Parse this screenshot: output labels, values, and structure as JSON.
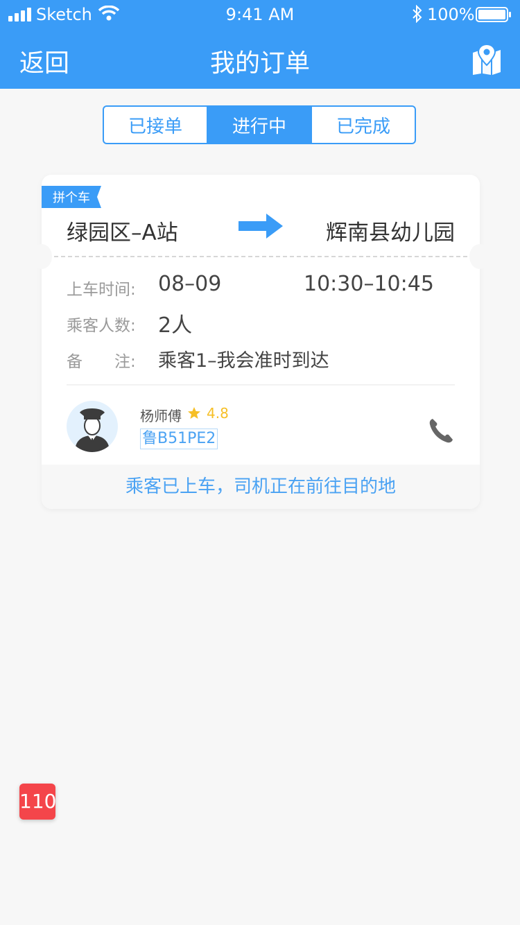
{
  "status_bar": {
    "carrier": "Sketch",
    "time": "9:41 AM",
    "battery": "100%"
  },
  "nav": {
    "back": "返回",
    "title": "我的订单",
    "map_icon": "map-pin-icon"
  },
  "tabs": [
    {
      "label": "已接单",
      "active": false
    },
    {
      "label": "进行中",
      "active": true
    },
    {
      "label": "已完成",
      "active": false
    }
  ],
  "order": {
    "ride_type": "拼个车",
    "from": "绿园区–A站",
    "to": "辉南县幼儿园",
    "pickup_label": "上车时间:",
    "date": "08–09",
    "time_window": "10:30–10:45",
    "passengers_label": "乘客人数:",
    "passengers": "2人",
    "note_label": "备　　注:",
    "note": "乘客1–我会准时到达",
    "driver_name": "杨师傅",
    "rating": "4.8",
    "plate": "鲁B51PE2",
    "status": "乘客已上车，司机正在前往目的地"
  },
  "sos": "110",
  "colors": {
    "primary": "#3a9cf7",
    "star": "#f6bf26",
    "sos": "#f4454a"
  }
}
